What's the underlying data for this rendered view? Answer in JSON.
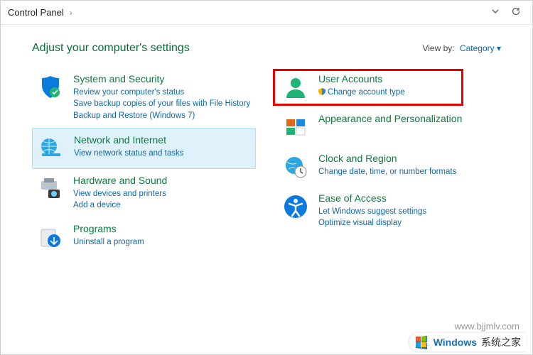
{
  "breadcrumb": {
    "root": "Control Panel"
  },
  "heading": "Adjust your computer's settings",
  "viewby": {
    "label": "View by:",
    "value": "Category"
  },
  "left": [
    {
      "title": "System and Security",
      "links": [
        "Review your computer's status",
        "Save backup copies of your files with File History",
        "Backup and Restore (Windows 7)"
      ]
    },
    {
      "title": "Network and Internet",
      "links": [
        "View network status and tasks"
      ]
    },
    {
      "title": "Hardware and Sound",
      "links": [
        "View devices and printers",
        "Add a device"
      ]
    },
    {
      "title": "Programs",
      "links": [
        "Uninstall a program"
      ]
    }
  ],
  "right": [
    {
      "title": "User Accounts",
      "links": [
        "Change account type"
      ],
      "shield_on_first": true
    },
    {
      "title": "Appearance and Personalization",
      "links": []
    },
    {
      "title": "Clock and Region",
      "links": [
        "Change date, time, or number formats"
      ]
    },
    {
      "title": "Ease of Access",
      "links": [
        "Let Windows suggest settings",
        "Optimize visual display"
      ]
    }
  ],
  "watermark": "www.bjjmlv.com",
  "brand": {
    "win": "Windows",
    "cn": "系统之家"
  }
}
